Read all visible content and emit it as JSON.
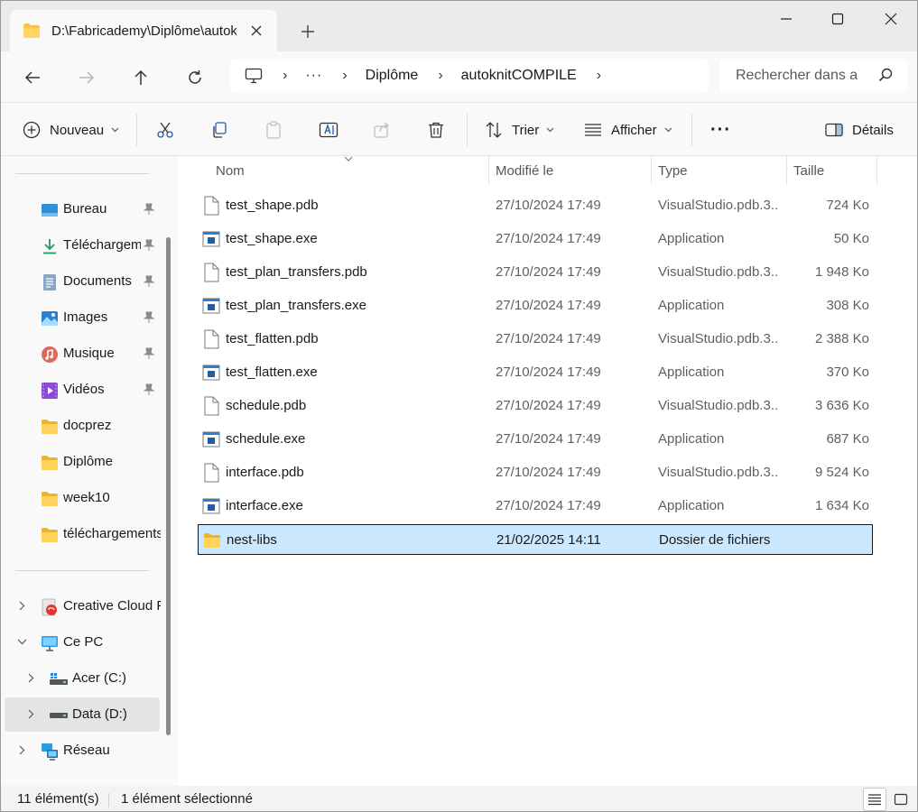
{
  "window": {
    "tab_title": "D:\\Fabricademy\\Diplôme\\autoknitCOMPILE",
    "controls": [
      "minimize-icon",
      "maximize-icon",
      "close-icon"
    ]
  },
  "address": {
    "dots": "···",
    "crumbs": [
      "Diplôme",
      "autoknitCOMPILE"
    ],
    "search_placeholder": "Rechercher dans autoknitCOMPILE"
  },
  "toolbar": {
    "new_label": "Nouveau",
    "sort_label": "Trier",
    "view_label": "Afficher",
    "more_label": "···",
    "details_label": "Détails"
  },
  "sidebar": {
    "quick": [
      {
        "label": "Bureau",
        "icon": "desktop-icon",
        "pinned": true
      },
      {
        "label": "Téléchargements",
        "icon": "download-icon",
        "pinned": true
      },
      {
        "label": "Documents",
        "icon": "documents-icon",
        "pinned": true
      },
      {
        "label": "Images",
        "icon": "images-icon",
        "pinned": true
      },
      {
        "label": "Musique",
        "icon": "music-icon",
        "pinned": true
      },
      {
        "label": "Vidéos",
        "icon": "videos-icon",
        "pinned": true
      },
      {
        "label": "docprez",
        "icon": "folder-icon",
        "pinned": false
      },
      {
        "label": "Diplôme",
        "icon": "folder-icon",
        "pinned": false
      },
      {
        "label": "week10",
        "icon": "folder-icon",
        "pinned": false
      },
      {
        "label": "téléchargements",
        "icon": "folder-icon",
        "pinned": false
      }
    ],
    "tree": [
      {
        "label": "Creative Cloud Files",
        "icon": "creative-cloud-icon",
        "chevron": "right"
      },
      {
        "label": "Ce PC",
        "icon": "pc-icon",
        "chevron": "down"
      },
      {
        "label": "Acer (C:)",
        "icon": "drive-c-icon",
        "chevron": "right"
      },
      {
        "label": "Data (D:)",
        "icon": "drive-icon",
        "chevron": "right"
      },
      {
        "label": "Réseau",
        "icon": "network-icon",
        "chevron": "right"
      }
    ]
  },
  "columns": {
    "name": "Nom",
    "modified": "Modifié le",
    "type": "Type",
    "size": "Taille"
  },
  "files": [
    {
      "name": "test_shape.pdb",
      "date": "27/10/2024 17:49",
      "type": "VisualStudio.pdb.3...",
      "size": "724 Ko",
      "icon": "file-icon"
    },
    {
      "name": "test_shape.exe",
      "date": "27/10/2024 17:49",
      "type": "Application",
      "size": "50 Ko",
      "icon": "exe-icon"
    },
    {
      "name": "test_plan_transfers.pdb",
      "date": "27/10/2024 17:49",
      "type": "VisualStudio.pdb.3...",
      "size": "1 948 Ko",
      "icon": "file-icon"
    },
    {
      "name": "test_plan_transfers.exe",
      "date": "27/10/2024 17:49",
      "type": "Application",
      "size": "308 Ko",
      "icon": "exe-icon"
    },
    {
      "name": "test_flatten.pdb",
      "date": "27/10/2024 17:49",
      "type": "VisualStudio.pdb.3...",
      "size": "2 388 Ko",
      "icon": "file-icon"
    },
    {
      "name": "test_flatten.exe",
      "date": "27/10/2024 17:49",
      "type": "Application",
      "size": "370 Ko",
      "icon": "exe-icon"
    },
    {
      "name": "schedule.pdb",
      "date": "27/10/2024 17:49",
      "type": "VisualStudio.pdb.3...",
      "size": "3 636 Ko",
      "icon": "file-icon"
    },
    {
      "name": "schedule.exe",
      "date": "27/10/2024 17:49",
      "type": "Application",
      "size": "687 Ko",
      "icon": "exe-icon"
    },
    {
      "name": "interface.pdb",
      "date": "27/10/2024 17:49",
      "type": "VisualStudio.pdb.3...",
      "size": "9 524 Ko",
      "icon": "file-icon"
    },
    {
      "name": "interface.exe",
      "date": "27/10/2024 17:49",
      "type": "Application",
      "size": "1 634 Ko",
      "icon": "exe-icon"
    },
    {
      "name": "nest-libs",
      "date": "21/02/2025 14:11",
      "type": "Dossier de fichiers",
      "size": "",
      "icon": "folder-icon",
      "selected": true
    }
  ],
  "status": {
    "count": "11 élément(s)",
    "selection": "1 élément sélectionné"
  },
  "colors": {
    "selection": "#cce8ff",
    "folder": "#f8c34a",
    "accent": "#0067c0"
  }
}
